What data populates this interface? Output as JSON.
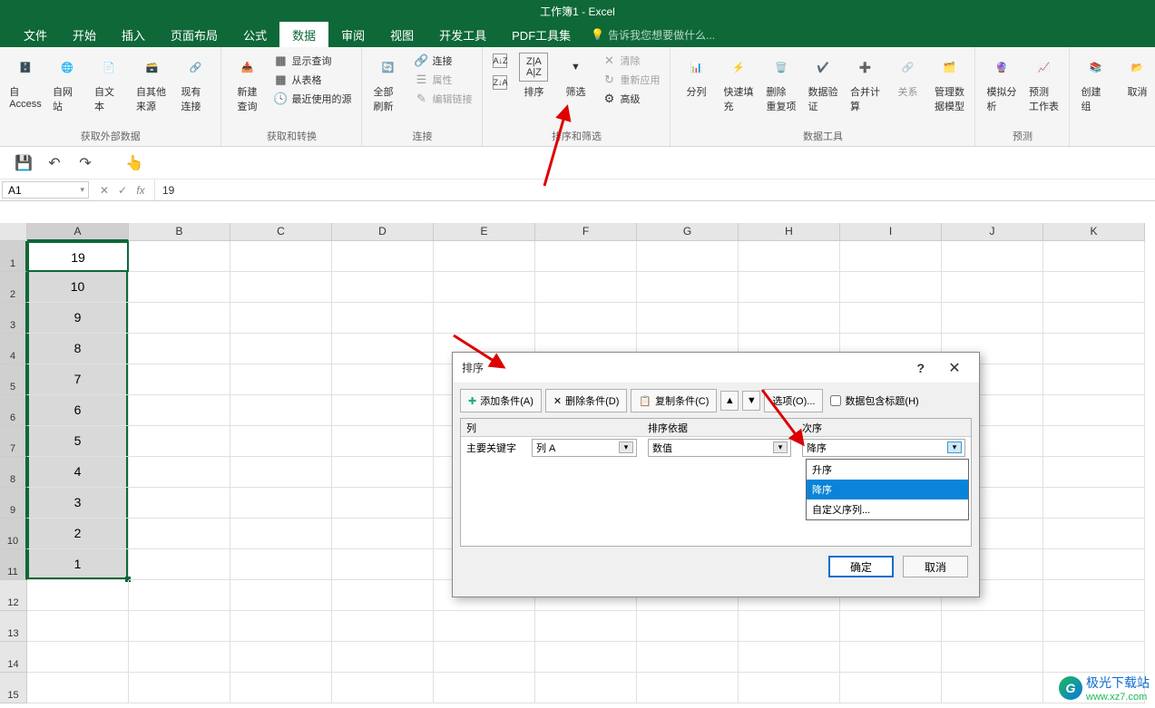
{
  "title": "工作簿1 - Excel",
  "tabs": [
    "文件",
    "开始",
    "插入",
    "页面布局",
    "公式",
    "数据",
    "审阅",
    "视图",
    "开发工具",
    "PDF工具集"
  ],
  "active_tab_index": 5,
  "tell_me": "告诉我您想要做什么...",
  "ribbon": {
    "g1": {
      "label": "获取外部数据",
      "items": [
        "自 Access",
        "自网站",
        "自文本",
        "自其他来源",
        "现有连接"
      ]
    },
    "g2": {
      "label": "获取和转换",
      "big": "新建\n查询",
      "items": [
        "显示查询",
        "从表格",
        "最近使用的源"
      ]
    },
    "g3": {
      "label": "连接",
      "big": "全部刷新",
      "items": [
        "连接",
        "属性",
        "编辑链接"
      ]
    },
    "g4": {
      "label": "排序和筛选",
      "sort_asc": "A→Z",
      "sort_desc": "Z→A",
      "sort": "排序",
      "filter": "筛选",
      "clear": "清除",
      "reapply": "重新应用",
      "adv": "高级"
    },
    "g5": {
      "label": "数据工具",
      "items": [
        "分列",
        "快速填充",
        "删除\n重复项",
        "数据验\n证",
        "合并计算",
        "关系",
        "管理数\n据模型"
      ]
    },
    "g6": {
      "label": "预测",
      "items": [
        "模拟分析",
        "预测\n工作表"
      ]
    },
    "g7": {
      "items": [
        "创建组",
        "取消"
      ]
    }
  },
  "namebox": "A1",
  "formula_value": "19",
  "columns": [
    "A",
    "B",
    "C",
    "D",
    "E",
    "F",
    "G",
    "H",
    "I",
    "J",
    "K"
  ],
  "cells_colA": [
    "19",
    "10",
    "9",
    "8",
    "7",
    "6",
    "5",
    "4",
    "3",
    "2",
    "1"
  ],
  "row_count_visible": 15,
  "dialog": {
    "title": "排序",
    "help": "?",
    "btn_add": "添加条件(A)",
    "btn_del": "删除条件(D)",
    "btn_copy": "复制条件(C)",
    "btn_opts": "选项(O)...",
    "chk_header": "数据包含标题(H)",
    "col_h1": "列",
    "col_h2": "排序依据",
    "col_h3": "次序",
    "row_label": "主要关键字",
    "sel_col": "列 A",
    "sel_basis": "数值",
    "sel_order": "降序",
    "order_options": [
      "升序",
      "降序",
      "自定义序列..."
    ],
    "order_highlight_index": 1,
    "ok": "确定",
    "cancel": "取消"
  },
  "watermark": {
    "brand": "极光下载站",
    "url": "www.xz7.com"
  },
  "chart_data": null
}
